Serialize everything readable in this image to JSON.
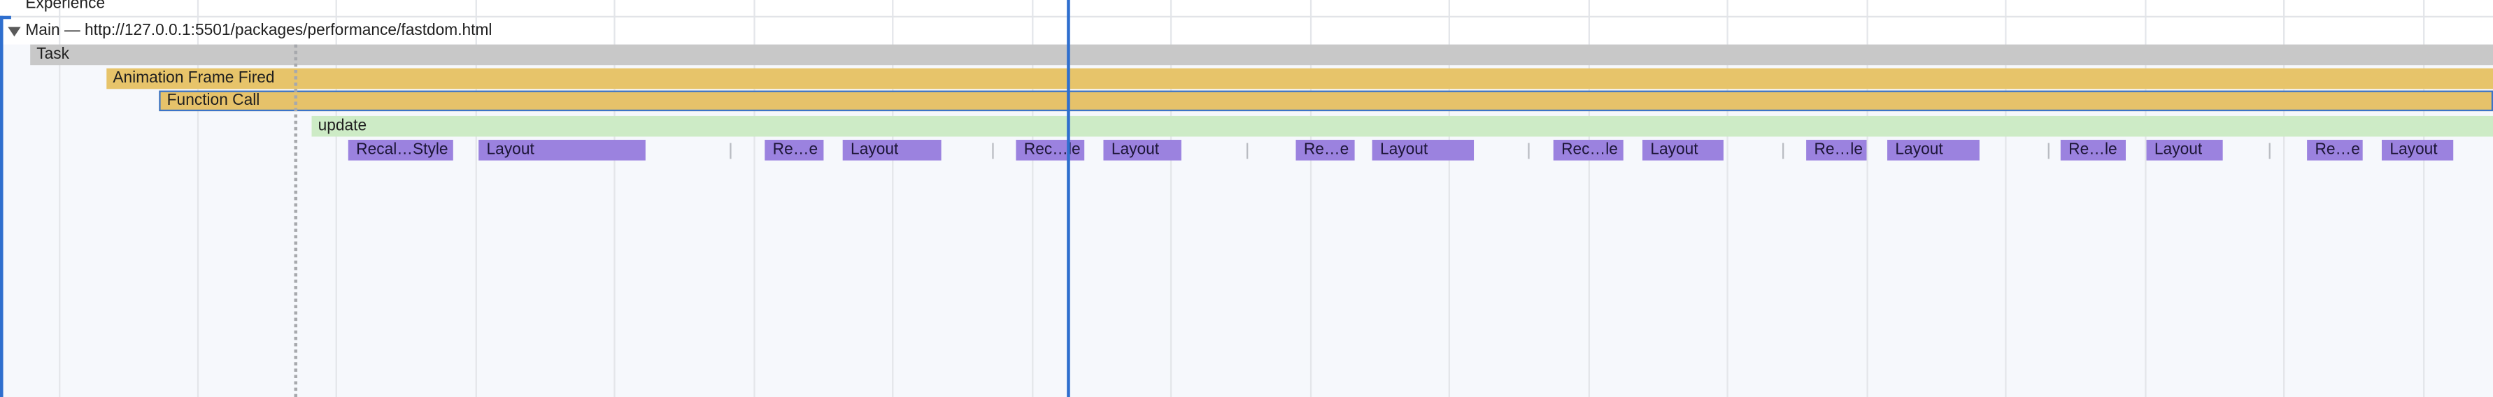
{
  "header": {
    "section_label": "Experience",
    "thread_label": "Main — http://127.0.0.1:5501/packages/performance/fastdom.html"
  },
  "flame": {
    "task": "Task",
    "animation_frame": "Animation Frame Fired",
    "function_call": "Function Call",
    "update": "update",
    "render_events": [
      {
        "label": "Recal…Style"
      },
      {
        "label": "Layout"
      },
      {
        "label": "Re…e"
      },
      {
        "label": "Layout"
      },
      {
        "label": "Rec…le"
      },
      {
        "label": "Layout"
      },
      {
        "label": "Re…e"
      },
      {
        "label": "Layout"
      },
      {
        "label": "Rec…le"
      },
      {
        "label": "Layout"
      },
      {
        "label": "Re…le"
      },
      {
        "label": "Layout"
      },
      {
        "label": "Re…le"
      },
      {
        "label": "Layout"
      },
      {
        "label": "Re…e"
      },
      {
        "label": "Layout"
      }
    ]
  },
  "colors": {
    "task": "#c8c8c8",
    "animation_frame": "#e7c46a",
    "update": "#cdebc6",
    "render": "#9b82df",
    "selection": "#2f6fce"
  }
}
